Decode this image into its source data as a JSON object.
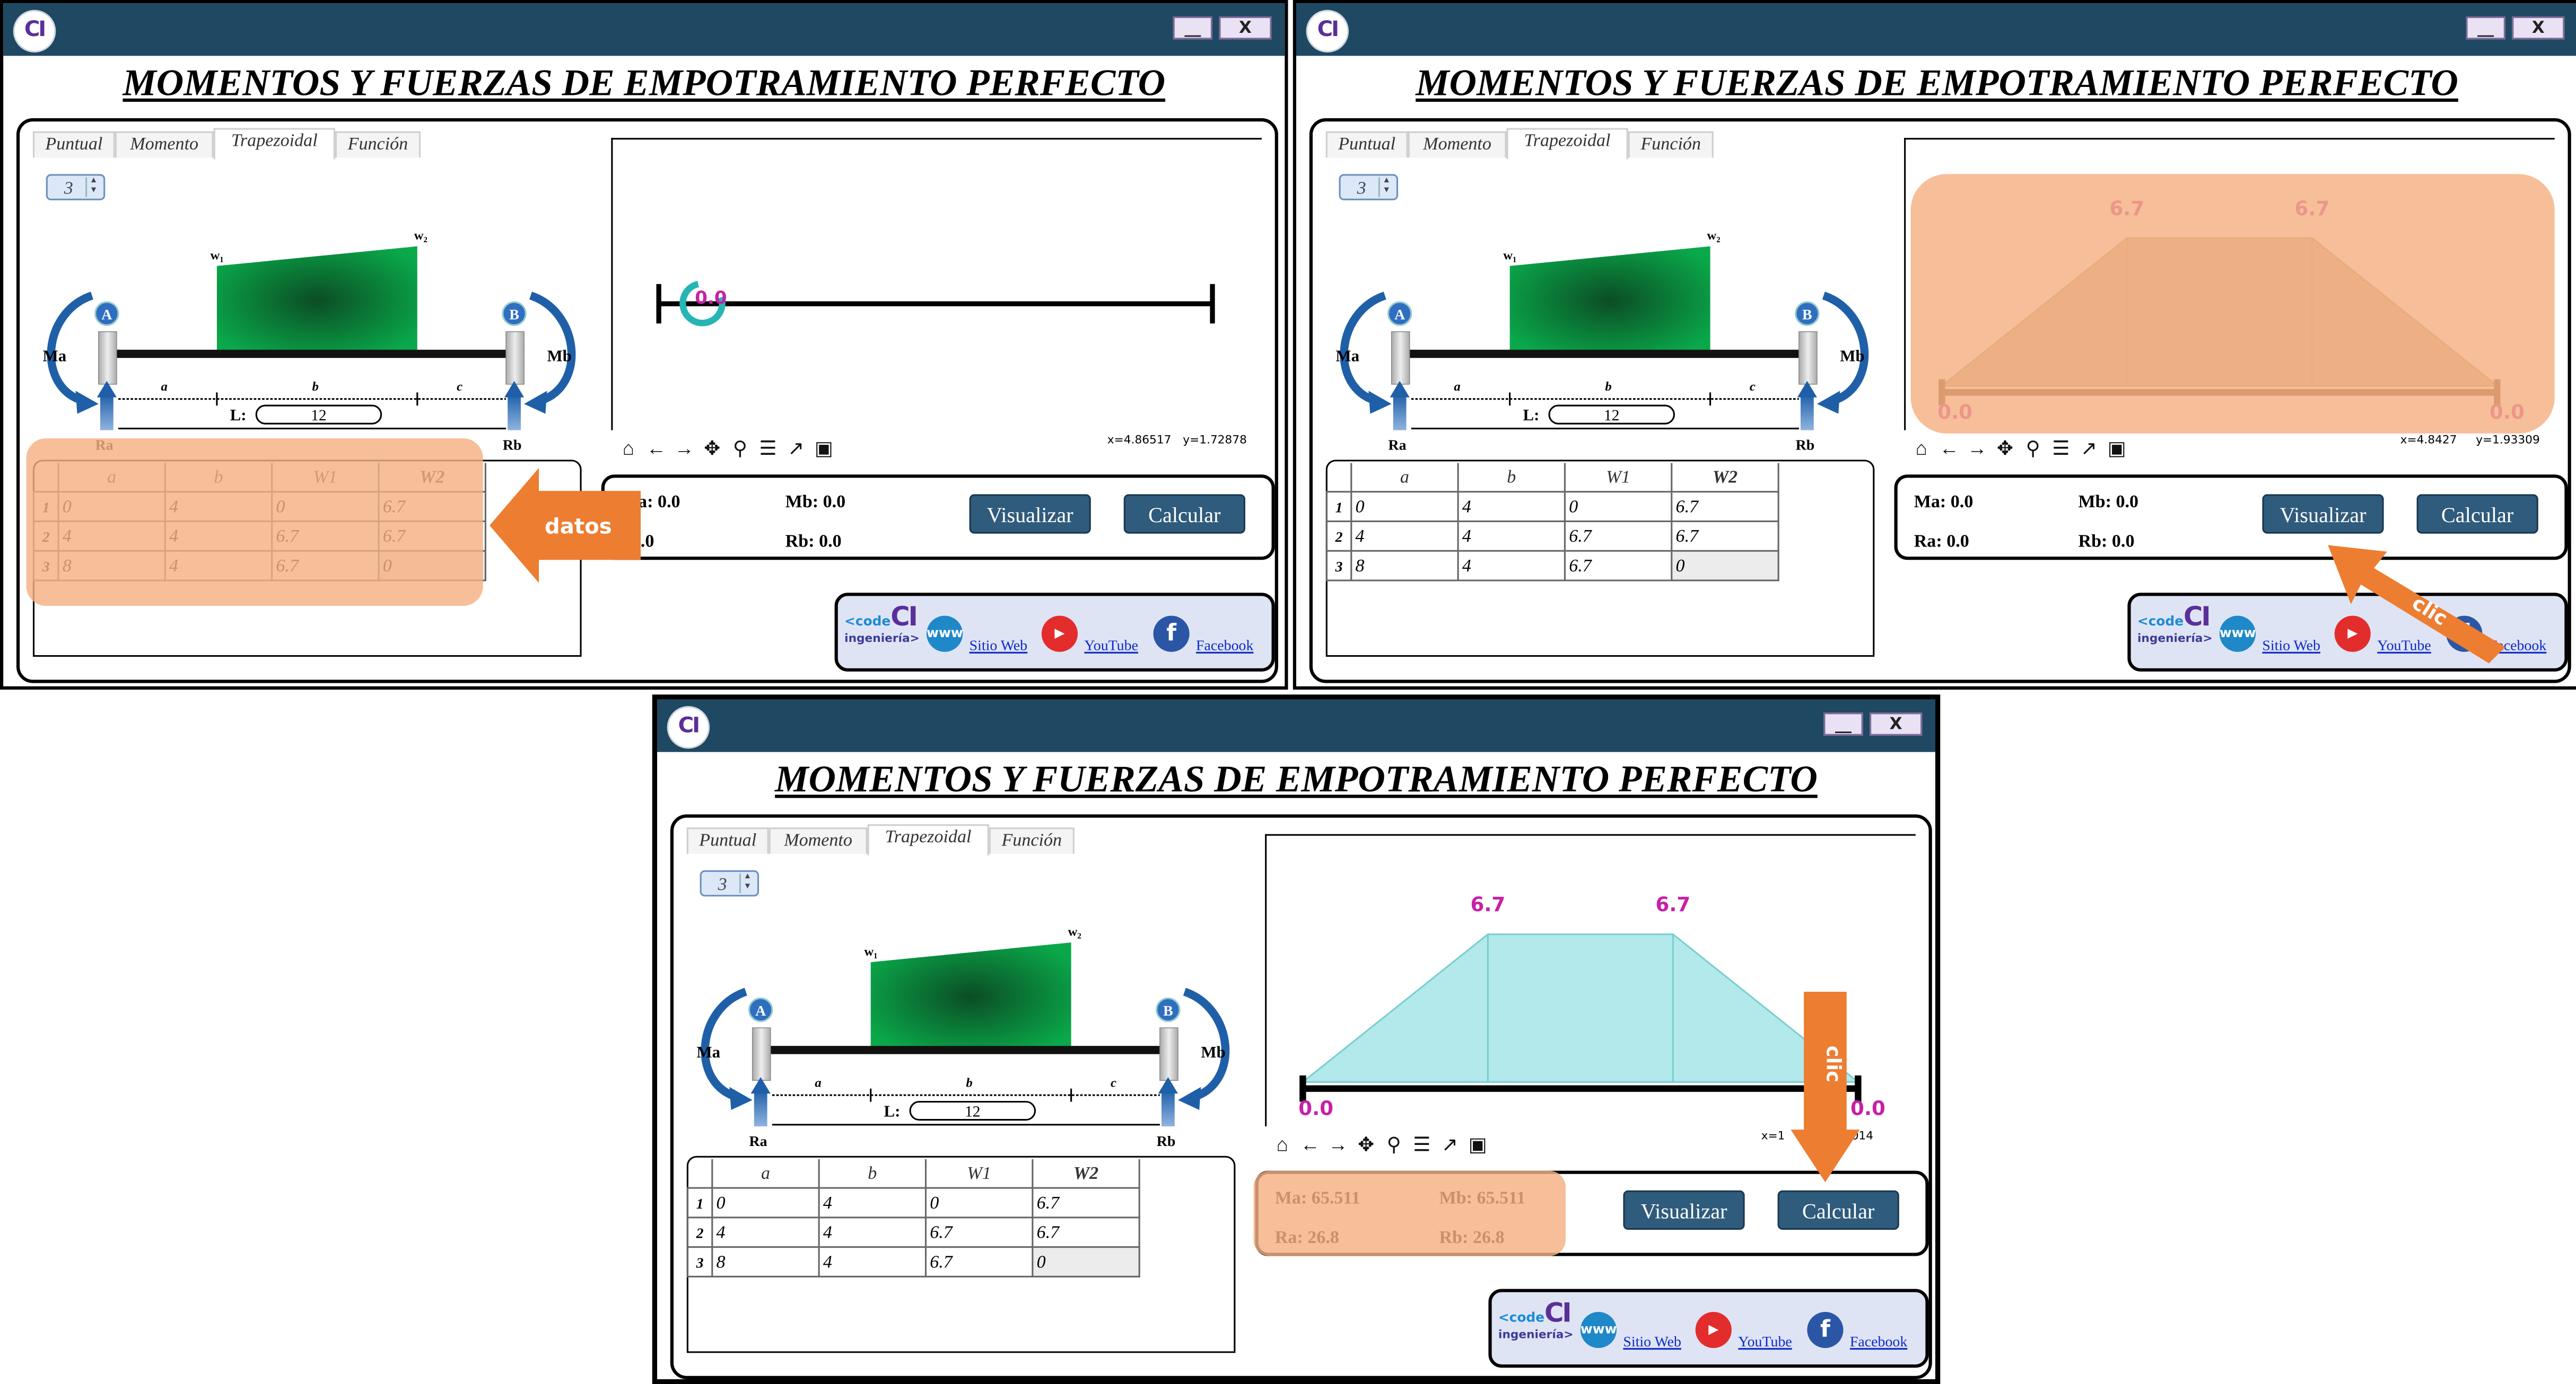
{
  "window": {
    "logo": "CI",
    "minimize_label": "__",
    "close_label": "X",
    "title": "MOMENTOS Y FUERZAS DE EMPOTRAMIENTO PERFECTO"
  },
  "tabs": [
    "Puntual",
    "Momento",
    "Trapezoidal",
    "Función"
  ],
  "spinner_value": "3",
  "diagram": {
    "w1": "w₁",
    "w2": "w₂",
    "A": "A",
    "B": "B",
    "Ma": "Ma",
    "Mb": "Mb",
    "Ra": "Ra",
    "Rb": "Rb",
    "a": "a",
    "b": "b",
    "c": "c",
    "L_label": "L:",
    "L_value": "12"
  },
  "table": {
    "headers": [
      "a",
      "b",
      "W1",
      "W2"
    ],
    "rows": [
      {
        "n": "1",
        "cells": [
          "0",
          "4",
          "0",
          "6.7"
        ]
      },
      {
        "n": "2",
        "cells": [
          "4",
          "4",
          "6.7",
          "6.7"
        ]
      },
      {
        "n": "3",
        "cells": [
          "8",
          "4",
          "6.7",
          "0"
        ]
      }
    ]
  },
  "buttons": {
    "visualizar": "Visualizar",
    "calcular": "Calcular"
  },
  "footer": {
    "brand_code": "<code",
    "brand_ci": "CI",
    "brand_ing": "ingeniería>",
    "www_icon": "www",
    "sitio": "Sitio Web",
    "youtube": "YouTube",
    "facebook": "Facebook"
  },
  "icons": [
    "home-icon",
    "back-icon",
    "forward-icon",
    "pan-icon",
    "zoom-icon",
    "configure-icon",
    "lines-icon",
    "save-icon"
  ],
  "panels": [
    {
      "coords": {
        "x": "x=4.86517",
        "y": "y=1.72878"
      },
      "results": {
        "ma": "Ma: 0.0",
        "mb": "Mb: 0.0",
        "ra": ": 0.0",
        "rb": "Rb: 0.0"
      },
      "plot": {
        "left_label": "0.0"
      },
      "annotation": "datos"
    },
    {
      "coords": {
        "x": "x=4.8427",
        "y": "y=1.93309"
      },
      "results": {
        "ma": "Ma: 0.0",
        "mb": "Mb: 0.0",
        "ra": "Ra: 0.0",
        "rb": "Rb: 0.0"
      },
      "plot": {
        "top_left": "6.7",
        "top_right": "6.7",
        "base_left": "0.0",
        "base_right": "0.0"
      },
      "annotation": "clic"
    },
    {
      "coords": {
        "x": "x=1",
        "y": "57014"
      },
      "results": {
        "ma": "Ma: 65.511",
        "mb": "Mb: 65.511",
        "ra": "Ra: 26.8",
        "rb": "Rb: 26.8"
      },
      "plot": {
        "top_left": "6.7",
        "top_right": "6.7",
        "base_left": "0.0",
        "base_right": "0.0"
      },
      "annotation": "clic"
    }
  ],
  "colors": {
    "titlebar": "#1f4862",
    "button": "#2f5b7c",
    "load": "#0aa84a",
    "highlight": "#f4b183",
    "arrow": "#ed7d31",
    "plot_fill": "#b3e9ea",
    "label_magenta": "#c81fa8"
  }
}
